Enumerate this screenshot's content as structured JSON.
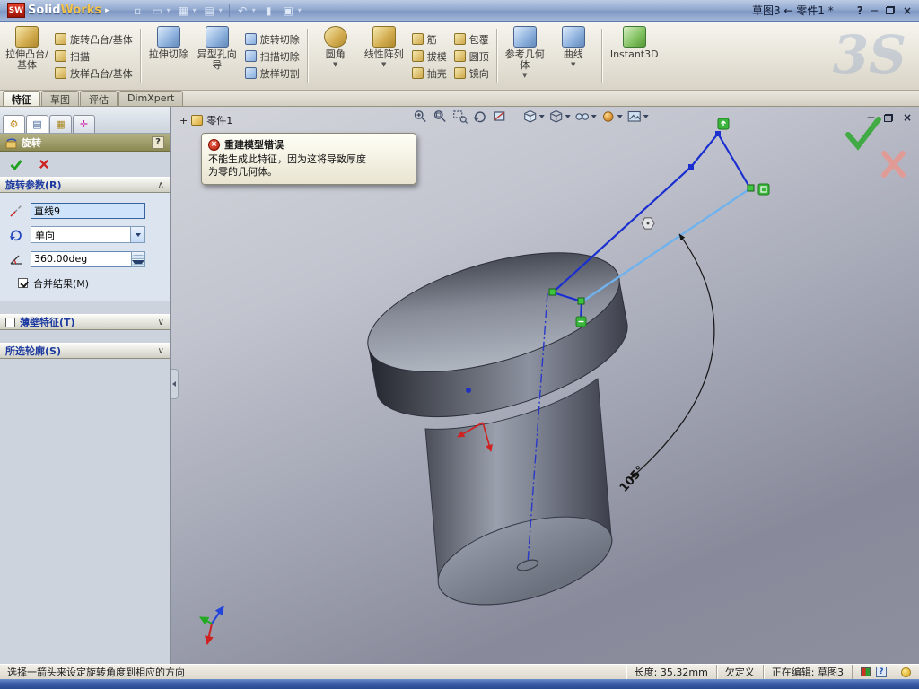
{
  "titlebar": {
    "logo": "SW",
    "brand_a": "Solid",
    "brand_b": "Works",
    "title": "草图3 ← 零件1 *",
    "help": "?",
    "minimize": "─",
    "close": "×"
  },
  "ribbon": {
    "extrude_boss": "拉伸凸台/基体",
    "revolve_boss": "旋转凸台/基体",
    "sweep": "扫描",
    "loft_boss": "放样凸台/基体",
    "extrude_cut": "拉伸切除",
    "hole_wizard": "异型孔向导",
    "revolve_cut": "旋转切除",
    "sweep_cut": "扫描切除",
    "loft_cut": "放样切割",
    "fillet": "圆角",
    "linear_pattern": "线性阵列",
    "rib": "筋",
    "draft": "拔模",
    "shell": "抽壳",
    "wrap": "包覆",
    "dome": "圆顶",
    "mirror": "镜向",
    "ref_geometry": "参考几何体",
    "curves": "曲线",
    "instant3d": "Instant3D"
  },
  "icons": {
    "ds_logo": "3S"
  },
  "tabs": {
    "features": "特征",
    "sketch": "草图",
    "evaluate": "评估",
    "dimxpert": "DimXpert"
  },
  "panel": {
    "title": "旋转",
    "help": "?",
    "params_header": "旋转参数(R)",
    "axis_value": "直线9",
    "direction_value": "单向",
    "angle_value": "360.00deg",
    "merge_label": "合并结果(M)",
    "thin_header": "薄壁特征(T)",
    "contours_header": "所选轮廓(S)"
  },
  "viewport": {
    "tree_root": "零件1",
    "warning_title": "重建模型错误",
    "warning_line1": "不能生成此特征，因为这将导致厚度",
    "warning_line2": "为零的几何体。",
    "dimension_label": "105°"
  },
  "status": {
    "message": "选择一箭头来设定旋转角度到相应的方向",
    "length": "长度: 35.32mm",
    "definition": "欠定义",
    "editing": "正在编辑: 草图3"
  },
  "colors": {
    "sketch_blue": "#1b2fd0",
    "selected_blue": "#6fb2ee",
    "relation_green": "#3ec43e",
    "error_red": "#cc2222",
    "panel_header_olive": "#8b8a54"
  }
}
